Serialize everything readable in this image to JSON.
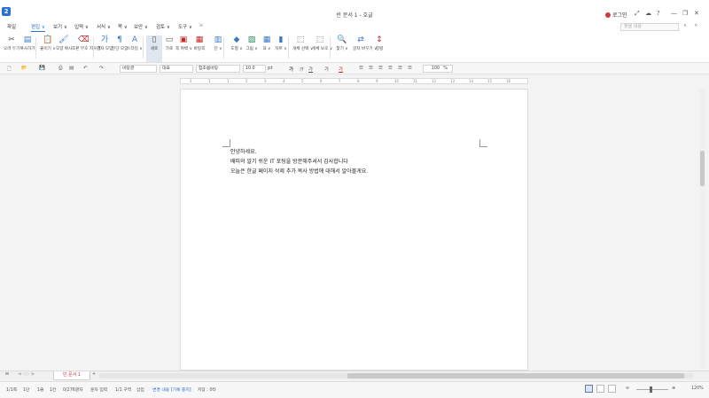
{
  "titlebar": {
    "logo": "2",
    "title": "빈 문서 1 - 호글",
    "login": "로그인",
    "icons": [
      "expand-icon",
      "cloud-icon",
      "help-icon",
      "minimize-icon",
      "restore-icon",
      "close-icon"
    ]
  },
  "menu": {
    "file": "파일",
    "tabs": [
      "편집 ∨",
      "보기 ∨",
      "입력 ∨",
      "서식 ∨",
      "쪽 ∨",
      "보안 ∨",
      "검토 ∨",
      "도구 ∨"
    ],
    "active_index": 0,
    "search_placeholder": "찾을 내용"
  },
  "ribbon": {
    "buttons": [
      {
        "label": "오려 두기"
      },
      {
        "label": "복사하기"
      },
      {
        "label": "붙이기 ∨"
      },
      {
        "label": "모양 복사"
      },
      {
        "label": "조판 부호 지우기"
      },
      {
        "label": "글자 모양"
      },
      {
        "label": "문단 모양"
      },
      {
        "label": "스타일 ∨"
      },
      {
        "label": "세로"
      },
      {
        "label": "가로"
      },
      {
        "label": "쪽 여백 ∨"
      },
      {
        "label": "바탕쪽"
      },
      {
        "label": "단 ∨"
      },
      {
        "label": "도형 ∨"
      },
      {
        "label": "그림 ∨"
      },
      {
        "label": "표 ∨"
      },
      {
        "label": "차트 ∨"
      },
      {
        "label": "개체 선택 ∨"
      },
      {
        "label": "개체 보호 ∨"
      },
      {
        "label": "찾기 ∨"
      },
      {
        "label": "글자 바꾸기 ∨"
      },
      {
        "label": "정렬"
      }
    ],
    "active_index": 8
  },
  "format": {
    "style": "바탕글",
    "lang": "대표",
    "font": "함초롬바탕",
    "size": "10.0",
    "unit": "pt",
    "zoom": "100",
    "zoom_unit": "%"
  },
  "ruler": {
    "numbers": [
      "2",
      "1",
      "1",
      "2",
      "3",
      "4",
      "5",
      "6",
      "7",
      "8",
      "9",
      "10",
      "11",
      "12",
      "13",
      "14",
      "15",
      "16"
    ]
  },
  "document": {
    "lines": [
      "안녕하세요.",
      "배피의 알기 쉬운 IT 포팅을 방문해주셔서 감사합니다",
      "오늘은 한글 페이지 삭제 추가 복사 방법에 대해서 알아볼게요."
    ]
  },
  "tabs": {
    "doc_tab": "빈 문서 1",
    "add": "+"
  },
  "status": {
    "page": "1/1쪽",
    "section": "1단",
    "line": "1줄",
    "col": "1칸",
    "chars": "0/276글자",
    "mode": "문자 입력",
    "pages": "1/1 구역",
    "insert": "삽입",
    "track": "변경 내용 [기록 중지]",
    "sync": "저장 : 0타",
    "zoom": "120%"
  }
}
